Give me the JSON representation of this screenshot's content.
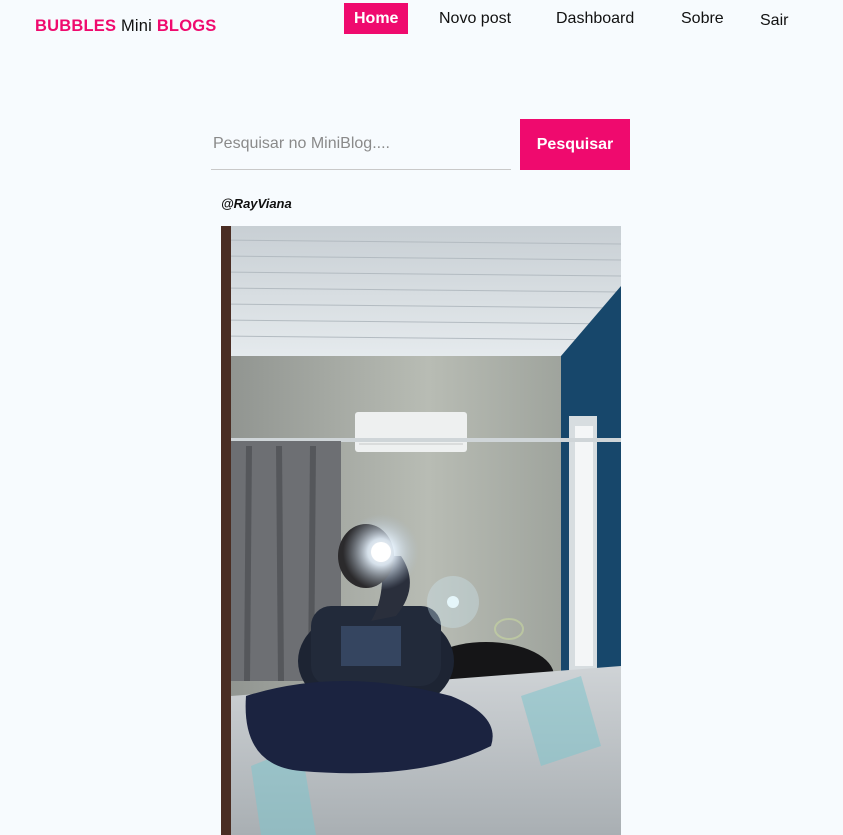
{
  "header": {
    "brand_part1": "BUBBLES",
    "brand_part2": "Mini",
    "brand_part3": "BLOGS",
    "nav": [
      {
        "label": "Home",
        "active": true
      },
      {
        "label": "Novo post",
        "active": false
      },
      {
        "label": "Dashboard",
        "active": false
      },
      {
        "label": "Sobre",
        "active": false
      },
      {
        "label": "Sair",
        "active": false
      }
    ]
  },
  "search": {
    "placeholder": "Pesquisar no MiniBlog....",
    "value": "",
    "button_label": "Pesquisar"
  },
  "post": {
    "author": "@RayViana"
  },
  "colors": {
    "accent": "#ef0a6e",
    "background": "#f7fbfe"
  }
}
